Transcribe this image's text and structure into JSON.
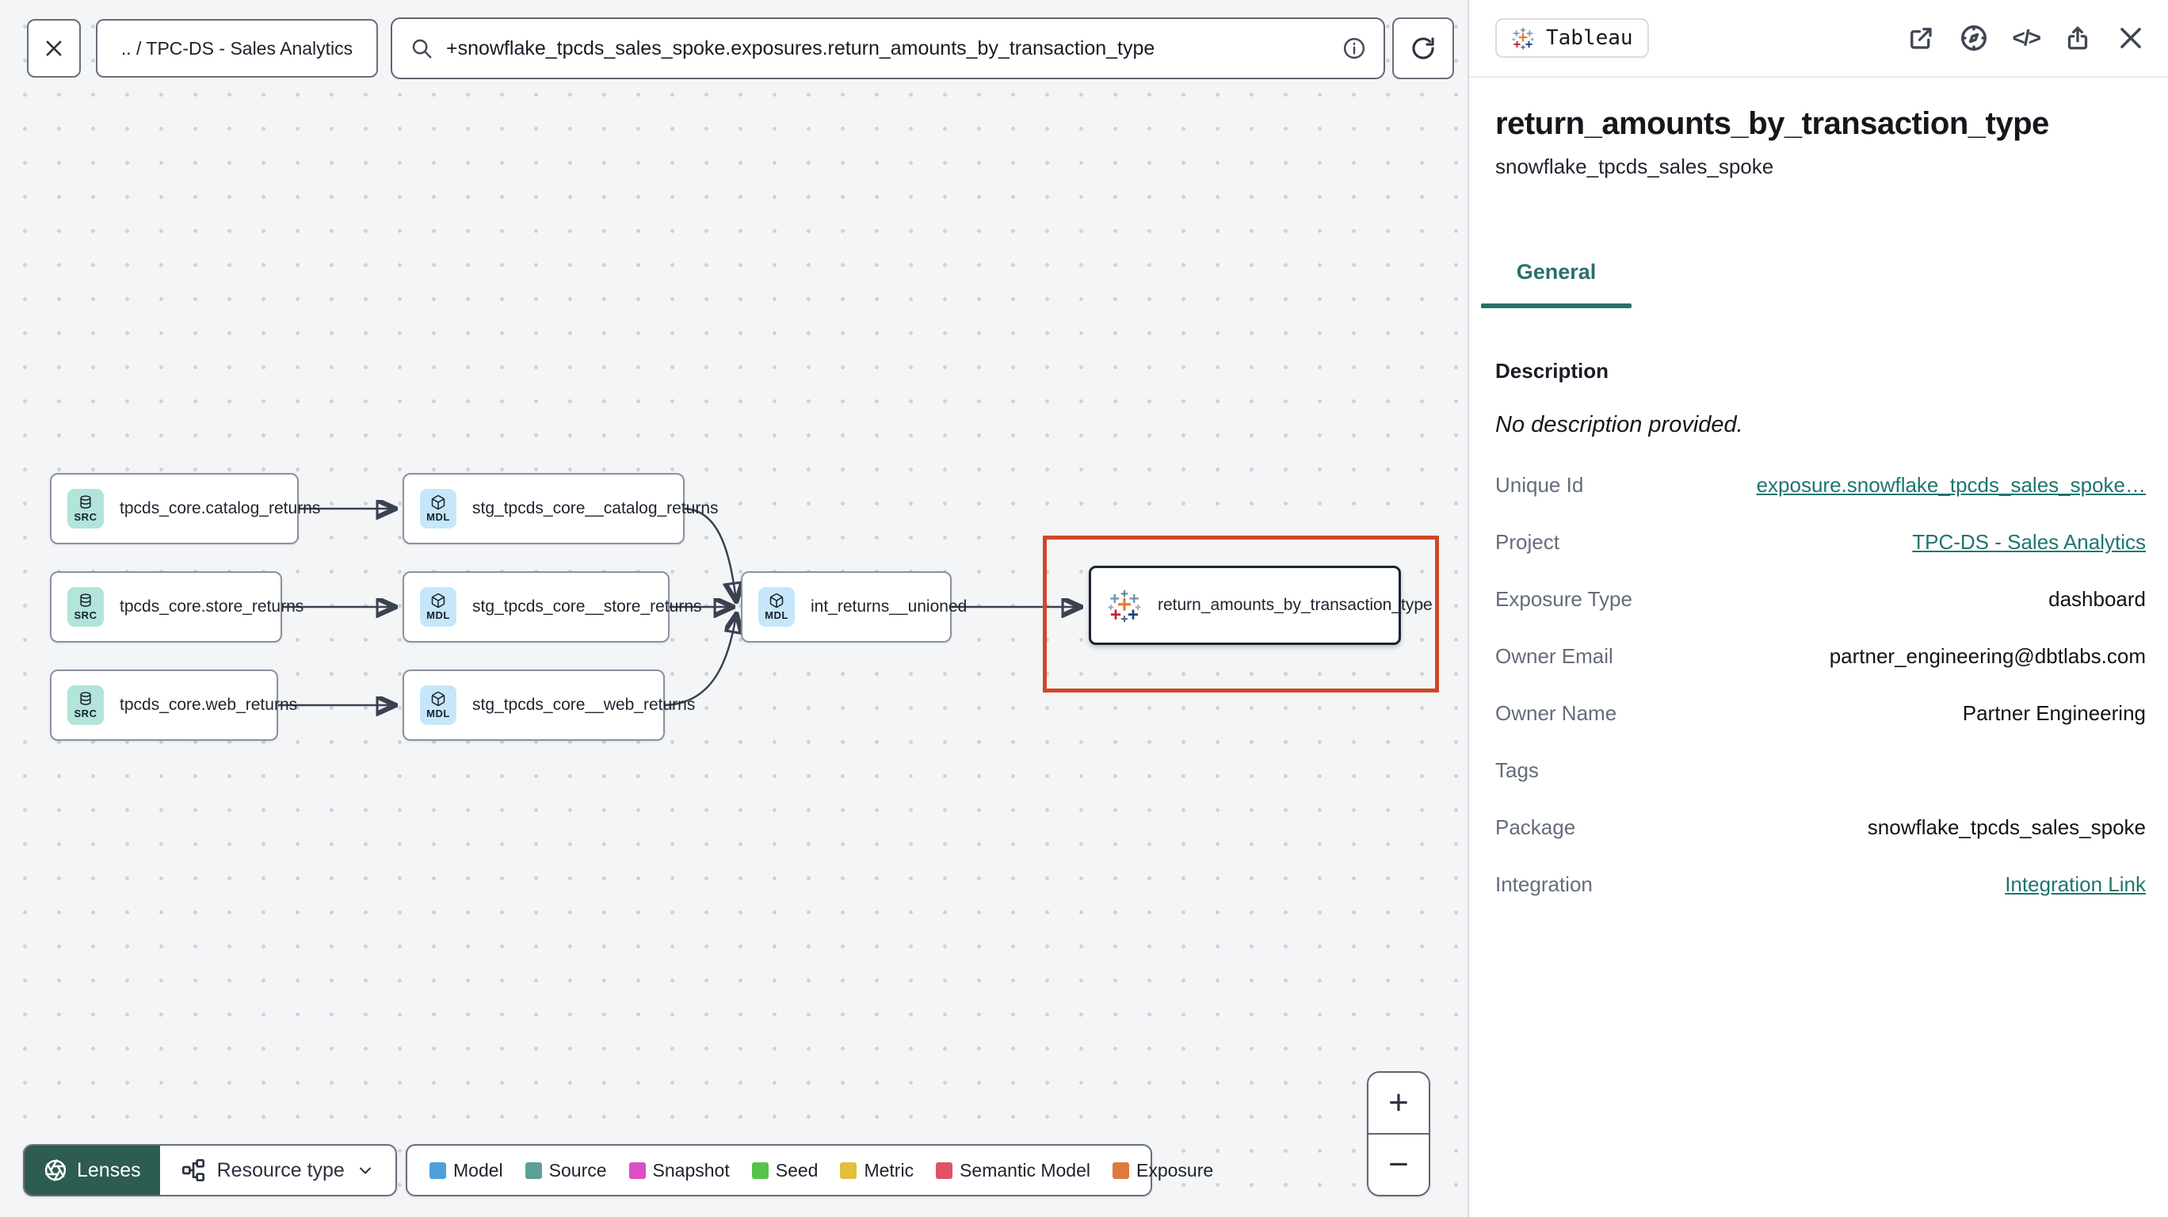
{
  "topbar": {
    "breadcrumb": ".. / TPC-DS - Sales Analytics",
    "search": {
      "value": "+snowflake_tpcds_sales_spoke.exposures.return_amounts_by_transaction_type"
    }
  },
  "graph": {
    "nodes": [
      {
        "type": "source",
        "badge": "SRC",
        "label": "tpcds_core.catalog_returns"
      },
      {
        "type": "source",
        "badge": "SRC",
        "label": "tpcds_core.store_returns"
      },
      {
        "type": "source",
        "badge": "SRC",
        "label": "tpcds_core.web_returns"
      },
      {
        "type": "model",
        "badge": "MDL",
        "label": "stg_tpcds_core__catalog_returns"
      },
      {
        "type": "model",
        "badge": "MDL",
        "label": "stg_tpcds_core__store_returns"
      },
      {
        "type": "model",
        "badge": "MDL",
        "label": "stg_tpcds_core__web_returns"
      },
      {
        "type": "model",
        "badge": "MDL",
        "label": "int_returns__unioned"
      },
      {
        "type": "exposure",
        "badge": "tableau-icon",
        "label": "return_amounts_by_transaction_type",
        "selected": true
      }
    ],
    "lenses_label": "Lenses",
    "resource_type_label": "Resource type",
    "legend": [
      {
        "label": "Model",
        "color": "#4e9fdc"
      },
      {
        "label": "Source",
        "color": "#5f9e99"
      },
      {
        "label": "Snapshot",
        "color": "#dc4fc5"
      },
      {
        "label": "Seed",
        "color": "#57c24a"
      },
      {
        "label": "Metric",
        "color": "#e2be3c"
      },
      {
        "label": "Semantic Model",
        "color": "#e25266"
      },
      {
        "label": "Exposure",
        "color": "#df7a3e"
      }
    ],
    "zoom_in_glyph": "+",
    "zoom_out_glyph": "−"
  },
  "panel": {
    "badge_label": "Tableau",
    "code_icon_glyph": "</>",
    "title": "return_amounts_by_transaction_type",
    "subtitle": "snowflake_tpcds_sales_spoke",
    "tab_general": "General",
    "description_label": "Description",
    "description_value": "No description provided.",
    "fields": [
      {
        "label": "Unique Id",
        "value": "exposure.snowflake_tpcds_sales_spoke…",
        "link": true
      },
      {
        "label": "Project",
        "value": "TPC-DS - Sales Analytics",
        "link": true
      },
      {
        "label": "Exposure Type",
        "value": "dashboard"
      },
      {
        "label": "Owner Email",
        "value": "partner_engineering@dbtlabs.com"
      },
      {
        "label": "Owner Name",
        "value": "Partner Engineering"
      },
      {
        "label": "Tags",
        "value": ""
      },
      {
        "label": "Package",
        "value": "snowflake_tpcds_sales_spoke"
      },
      {
        "label": "Integration",
        "value": "Integration Link",
        "link": true
      }
    ]
  }
}
